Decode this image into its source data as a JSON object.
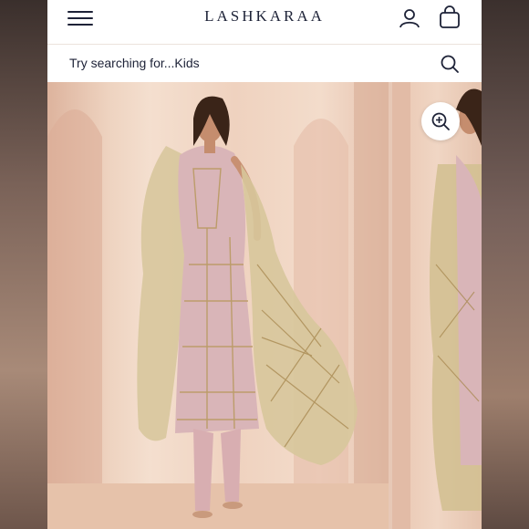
{
  "header": {
    "brand": "LASHKARAA",
    "menu_icon": "hamburger-menu-icon",
    "account_icon": "user-icon",
    "bag_icon": "shopping-bag-icon"
  },
  "search": {
    "placeholder": "Try searching for...Kids",
    "icon": "search-icon"
  },
  "gallery": {
    "zoom_icon": "zoom-in-icon",
    "colors": {
      "backdrop": "#f1d9c8",
      "outfit": "#d9b5b8",
      "embroidery": "#c9b07d"
    }
  }
}
